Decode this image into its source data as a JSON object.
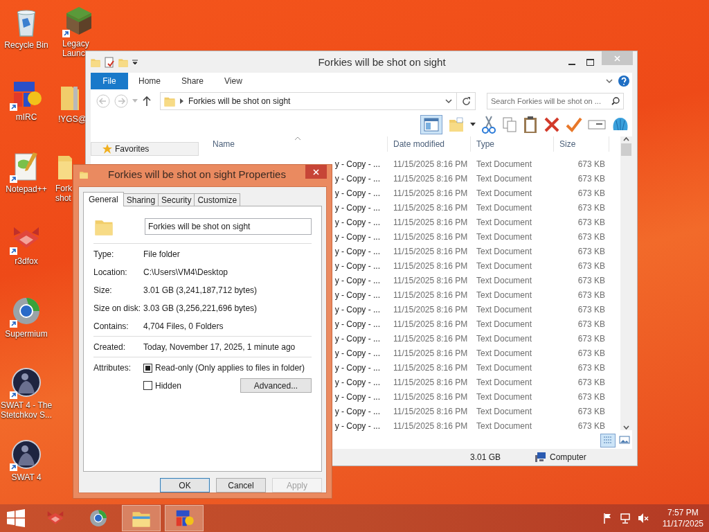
{
  "desktop_icons": [
    {
      "kind": "recycle-bin",
      "label": "Recycle Bin",
      "shortcut": false
    },
    {
      "kind": "grass-block",
      "label": "Legacy Launc",
      "shortcut": true
    },
    {
      "kind": "mirc",
      "label": "mIRC",
      "shortcut": true
    },
    {
      "kind": "zip-folder",
      "label": "!YGS@",
      "shortcut": false
    },
    {
      "kind": "notepad",
      "label": "Notepad++",
      "shortcut": true
    },
    {
      "kind": "folder",
      "label": "Fork shot",
      "shortcut": false
    },
    {
      "kind": "r3dfox",
      "label": "r3dfox",
      "shortcut": true
    },
    {
      "kind": "supermium",
      "label": "Supermium",
      "shortcut": true
    },
    {
      "kind": "swat",
      "label": "SWAT 4 - The Stetchkov S...",
      "shortcut": true
    },
    {
      "kind": "swat",
      "label": "SWAT 4",
      "shortcut": true
    }
  ],
  "explorer": {
    "title": "Forkies will be shot on sight",
    "file_tab": "File",
    "ribbon_tabs": [
      "Home",
      "Share",
      "View"
    ],
    "address": "Forkies will be shot on sight",
    "search": {
      "placeholder": "Search Forkies will be shot on ..."
    },
    "nav": [
      {
        "label": "Favorites"
      }
    ],
    "columns": [
      "Name",
      "Date modified",
      "Type",
      "Size"
    ],
    "rows": [
      {
        "name": "y - Copy - ...",
        "date": "11/15/2025 8:16 PM",
        "type": "Text Document",
        "size": "673 KB"
      },
      {
        "name": "y - Copy - ...",
        "date": "11/15/2025 8:16 PM",
        "type": "Text Document",
        "size": "673 KB"
      },
      {
        "name": "y - Copy - ...",
        "date": "11/15/2025 8:16 PM",
        "type": "Text Document",
        "size": "673 KB"
      },
      {
        "name": "y - Copy - ...",
        "date": "11/15/2025 8:16 PM",
        "type": "Text Document",
        "size": "673 KB"
      },
      {
        "name": "y - Copy - ...",
        "date": "11/15/2025 8:16 PM",
        "type": "Text Document",
        "size": "673 KB"
      },
      {
        "name": "y - Copy - ...",
        "date": "11/15/2025 8:16 PM",
        "type": "Text Document",
        "size": "673 KB"
      },
      {
        "name": "y - Copy - ...",
        "date": "11/15/2025 8:16 PM",
        "type": "Text Document",
        "size": "673 KB"
      },
      {
        "name": "y - Copy - ...",
        "date": "11/15/2025 8:16 PM",
        "type": "Text Document",
        "size": "673 KB"
      },
      {
        "name": "y - Copy - ...",
        "date": "11/15/2025 8:16 PM",
        "type": "Text Document",
        "size": "673 KB"
      },
      {
        "name": "y - Copy - ...",
        "date": "11/15/2025 8:16 PM",
        "type": "Text Document",
        "size": "673 KB"
      },
      {
        "name": "y - Copy - ...",
        "date": "11/15/2025 8:16 PM",
        "type": "Text Document",
        "size": "673 KB"
      },
      {
        "name": "y - Copy - ...",
        "date": "11/15/2025 8:16 PM",
        "type": "Text Document",
        "size": "673 KB"
      },
      {
        "name": "y - Copy - ...",
        "date": "11/15/2025 8:16 PM",
        "type": "Text Document",
        "size": "673 KB"
      },
      {
        "name": "y - Copy - ...",
        "date": "11/15/2025 8:16 PM",
        "type": "Text Document",
        "size": "673 KB"
      },
      {
        "name": "y - Copy - ...",
        "date": "11/15/2025 8:16 PM",
        "type": "Text Document",
        "size": "673 KB"
      },
      {
        "name": "y - Copy - ...",
        "date": "11/15/2025 8:16 PM",
        "type": "Text Document",
        "size": "673 KB"
      },
      {
        "name": "y - Copy - ...",
        "date": "11/15/2025 8:16 PM",
        "type": "Text Document",
        "size": "673 KB"
      },
      {
        "name": "y - Copy - ...",
        "date": "11/15/2025 8:16 PM",
        "type": "Text Document",
        "size": "673 KB"
      },
      {
        "name": "y - Copy - ...",
        "date": "11/15/2025 8:16 PM",
        "type": "Text Document",
        "size": "673 KB"
      }
    ],
    "status": {
      "size": "3.01 GB",
      "location": "Computer"
    }
  },
  "dialog": {
    "title": "Forkies will be shot on sight Properties",
    "tabs": [
      {
        "label": "General",
        "selected": true
      },
      {
        "label": "Sharing",
        "selected": false
      },
      {
        "label": "Security",
        "selected": false
      },
      {
        "label": "Customize",
        "selected": false
      }
    ],
    "name_value": "Forkies will be shot on sight",
    "sections": [
      [
        {
          "label": "Type:",
          "value": "File folder"
        },
        {
          "label": "Location:",
          "value": "C:\\Users\\VM4\\Desktop"
        },
        {
          "label": "Size:",
          "value": "3.01 GB (3,241,187,712 bytes)"
        },
        {
          "label": "Size on disk:",
          "value": "3.03 GB (3,256,221,696 bytes)"
        },
        {
          "label": "Contains:",
          "value": "4,704 Files, 0 Folders"
        }
      ],
      [
        {
          "label": "Created:",
          "value": "Today, November 17, 2025, 1 minute ago"
        }
      ]
    ],
    "attributes": {
      "label": "Attributes:",
      "options": [
        {
          "label": "Read-only (Only applies to files in folder)",
          "checked": true
        },
        {
          "label": "Hidden",
          "checked": false
        }
      ],
      "advanced": "Advanced..."
    },
    "buttons": [
      {
        "label": "OK",
        "default": true,
        "disabled": false
      },
      {
        "label": "Cancel",
        "default": false,
        "disabled": false
      },
      {
        "label": "Apply",
        "default": false,
        "disabled": true
      }
    ]
  },
  "taskbar": {
    "apps": [
      {
        "kind": "r3dfox",
        "running": false
      },
      {
        "kind": "supermium",
        "running": false
      },
      {
        "kind": "explorer",
        "running": true
      },
      {
        "kind": "mirc",
        "running": true
      }
    ],
    "clock": {
      "time": "7:57 PM",
      "date": "11/17/2025"
    }
  }
}
